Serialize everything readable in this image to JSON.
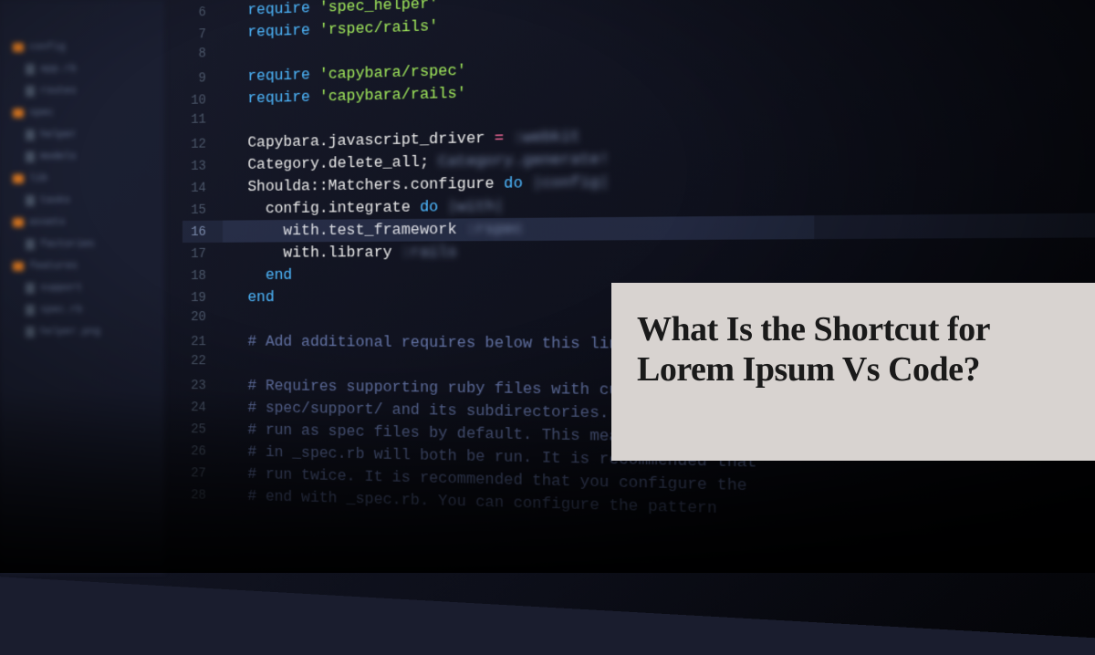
{
  "sidebar": {
    "items": [
      {
        "type": "folder",
        "label": "config"
      },
      {
        "type": "file",
        "label": "app.rb"
      },
      {
        "type": "file",
        "label": "routes"
      },
      {
        "type": "folder",
        "label": "spec"
      },
      {
        "type": "file",
        "label": "helper"
      },
      {
        "type": "file",
        "label": "models"
      },
      {
        "type": "folder",
        "label": "lib"
      },
      {
        "type": "file",
        "label": "tasks"
      },
      {
        "type": "folder",
        "label": "assets"
      },
      {
        "type": "file",
        "label": "factories"
      },
      {
        "type": "folder",
        "label": "features"
      },
      {
        "type": "file",
        "label": "support"
      },
      {
        "type": "file",
        "label": "spec.rb"
      },
      {
        "type": "file",
        "label": "helper.png"
      }
    ]
  },
  "code": {
    "lines": [
      {
        "n": "6",
        "indent": 1,
        "kw": "require",
        "str": "'spec_helper'"
      },
      {
        "n": "7",
        "indent": 1,
        "kw": "require",
        "str": "'rspec/rails'"
      },
      {
        "n": "8",
        "indent": 0,
        "empty": true
      },
      {
        "n": "9",
        "indent": 1,
        "kw": "require",
        "str": "'capybara/rspec'"
      },
      {
        "n": "10",
        "indent": 1,
        "kw": "require",
        "str": "'capybara/rails'"
      },
      {
        "n": "11",
        "indent": 0,
        "empty": true
      },
      {
        "n": "12",
        "indent": 1,
        "chain": "Capybara.javascript_driver",
        "op": "=",
        "blur": ":webkit"
      },
      {
        "n": "13",
        "indent": 1,
        "chain": "Category.delete_all;",
        "blur": "Category.generate!"
      },
      {
        "n": "14",
        "indent": 1,
        "chain": "Shoulda::Matchers.configure",
        "kw2": "do",
        "blur": "|config|",
        "gutter": true
      },
      {
        "n": "15",
        "indent": 2,
        "chain": "config.integrate",
        "kw2": "do",
        "blur": "|with|",
        "gutter": true
      },
      {
        "n": "16",
        "indent": 3,
        "chain": "with.test_framework",
        "blur": ":rspec",
        "gutter": true,
        "active": true,
        "highlight": true
      },
      {
        "n": "17",
        "indent": 3,
        "chain": "with.library",
        "blur": ":rails"
      },
      {
        "n": "18",
        "indent": 2,
        "kw": "end"
      },
      {
        "n": "19",
        "indent": 1,
        "kw": "end"
      },
      {
        "n": "20",
        "indent": 0,
        "empty": true
      },
      {
        "n": "21",
        "indent": 1,
        "com": "# Add additional requires below this line. Rails is not"
      },
      {
        "n": "22",
        "indent": 0,
        "empty": true
      },
      {
        "n": "23",
        "indent": 1,
        "com": "# Requires supporting ruby files with custom matchers"
      },
      {
        "n": "24",
        "indent": 1,
        "com": "# spec/support/ and its subdirectories. This means that"
      },
      {
        "n": "25",
        "indent": 1,
        "com": "# run as spec files by default. This means that in"
      },
      {
        "n": "26",
        "indent": 1,
        "com": "# in _spec.rb will both be run. It is recommended that"
      },
      {
        "n": "27",
        "indent": 1,
        "com": "# run twice. It is recommended that you configure the"
      },
      {
        "n": "28",
        "indent": 1,
        "com": "# end with _spec.rb. You can configure the pattern"
      }
    ]
  },
  "overlay": {
    "title": "What Is the Shortcut for Lorem Ipsum Vs Code?"
  }
}
